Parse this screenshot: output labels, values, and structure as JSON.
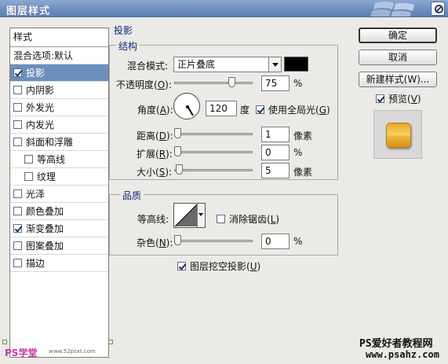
{
  "window": {
    "title": "图层样式"
  },
  "styles_panel": {
    "header": "样式",
    "items": [
      {
        "label": "混合选项:默认",
        "checkbox": false,
        "checked": false,
        "selected": false,
        "indent": false
      },
      {
        "label": "投影",
        "checkbox": true,
        "checked": true,
        "selected": true,
        "indent": false
      },
      {
        "label": "内阴影",
        "checkbox": true,
        "checked": false,
        "selected": false,
        "indent": false
      },
      {
        "label": "外发光",
        "checkbox": true,
        "checked": false,
        "selected": false,
        "indent": false
      },
      {
        "label": "内发光",
        "checkbox": true,
        "checked": false,
        "selected": false,
        "indent": false
      },
      {
        "label": "斜面和浮雕",
        "checkbox": true,
        "checked": false,
        "selected": false,
        "indent": false
      },
      {
        "label": "等高线",
        "checkbox": true,
        "checked": false,
        "selected": false,
        "indent": true
      },
      {
        "label": "纹理",
        "checkbox": true,
        "checked": false,
        "selected": false,
        "indent": true
      },
      {
        "label": "光泽",
        "checkbox": true,
        "checked": false,
        "selected": false,
        "indent": false
      },
      {
        "label": "颜色叠加",
        "checkbox": true,
        "checked": false,
        "selected": false,
        "indent": false
      },
      {
        "label": "渐变叠加",
        "checkbox": true,
        "checked": true,
        "selected": false,
        "indent": false
      },
      {
        "label": "图案叠加",
        "checkbox": true,
        "checked": false,
        "selected": false,
        "indent": false
      },
      {
        "label": "描边",
        "checkbox": true,
        "checked": false,
        "selected": false,
        "indent": false
      }
    ]
  },
  "drop_shadow": {
    "section_title": "投影",
    "structure": {
      "title": "结构",
      "blend_mode": {
        "label": "混合模式:",
        "value": "正片叠底",
        "color": "#000000"
      },
      "opacity": {
        "label": "不透明度(O):",
        "label_text": "不透明度(",
        "label_key": "O",
        "label_tail": "):",
        "value": "75",
        "unit": "%",
        "level": 75
      },
      "angle": {
        "label_text": "角度(",
        "label_key": "A",
        "label_tail": "):",
        "value": "120",
        "unit": "度",
        "degrees": 120
      },
      "global_light": {
        "label_text": "使用全局光(",
        "label_key": "G",
        "label_tail": ")",
        "checked": true
      },
      "distance": {
        "label_text": "距离(",
        "label_key": "D",
        "label_tail": "):",
        "value": "1",
        "unit": "像素",
        "level": 0.4
      },
      "spread": {
        "label_text": "扩展(",
        "label_key": "R",
        "label_tail": "):",
        "value": "0",
        "unit": "%",
        "level": 0
      },
      "size": {
        "label_text": "大小(",
        "label_key": "S",
        "label_tail": "):",
        "value": "5",
        "unit": "像素",
        "level": 2
      }
    },
    "quality": {
      "title": "品质",
      "contour": {
        "label": "等高线:"
      },
      "anti_alias": {
        "label_text": "消除锯齿(",
        "label_key": "L",
        "label_tail": ")",
        "checked": false
      },
      "noise": {
        "label_text": "杂色(",
        "label_key": "N",
        "label_tail": "):",
        "value": "0",
        "unit": "%",
        "level": 0
      }
    },
    "knockout": {
      "label_text": "图层挖空投影(",
      "label_key": "U",
      "label_tail": ")",
      "checked": true
    }
  },
  "buttons": {
    "ok": "确定",
    "cancel": "取消",
    "new_style": "新建样式(W)...",
    "preview": {
      "label_text": "预览(",
      "label_key": "V",
      "label_tail": ")",
      "checked": true
    }
  },
  "watermarks": {
    "bottom_left": "PS学堂",
    "bottom_left_site": "www.52psxt.com",
    "bottom_right_title": "PS爱好者教程网",
    "bottom_right_url": "www.psahz.com"
  },
  "colors": {
    "selection": "#6d8fbd",
    "titlebar": "#7091c2",
    "group_title": "#0a2a78",
    "preview_gold": "#f0b63a"
  }
}
